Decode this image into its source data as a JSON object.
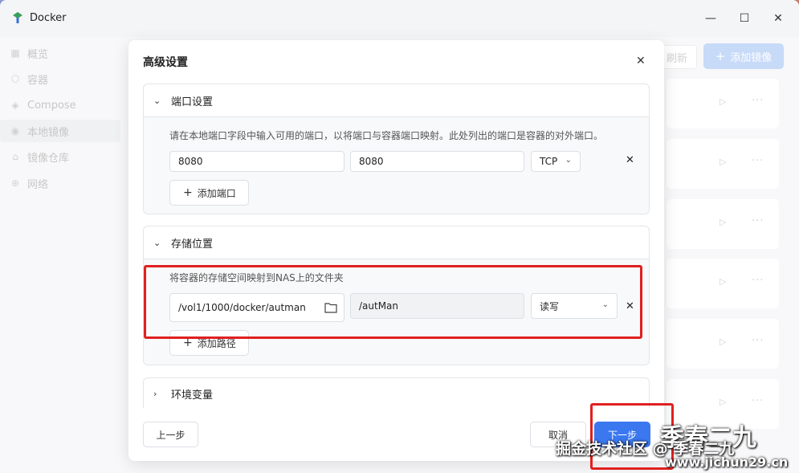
{
  "window": {
    "title": "Docker",
    "controls": {
      "minimize": "—",
      "maximize": "☐",
      "close": "✕"
    }
  },
  "sidebar": {
    "items": [
      {
        "label": "概览",
        "icon": "grid-icon"
      },
      {
        "label": "容器",
        "icon": "cube-icon"
      },
      {
        "label": "Compose",
        "icon": "layers-icon"
      },
      {
        "label": "本地镜像",
        "icon": "disk-icon",
        "active": true
      },
      {
        "label": "镜像仓库",
        "icon": "house-icon"
      },
      {
        "label": "网络",
        "icon": "globe-icon"
      }
    ]
  },
  "background": {
    "refresh_label": "刷新",
    "add_image_label": "添加镜像",
    "add_icon": "plus-icon"
  },
  "dialog": {
    "title": "高级设置",
    "close": "✕",
    "ports": {
      "title": "端口设置",
      "description": "请在本地端口字段中输入可用的端口，以将端口与容器端口映射。此处列出的端口是容器的对外端口。",
      "rows": [
        {
          "local_port": "8080",
          "container_port": "8080",
          "protocol": "TCP"
        }
      ],
      "add_label": "添加端口"
    },
    "storage": {
      "title": "存储位置",
      "description": "将容器的存储空间映射到NAS上的文件夹",
      "rows": [
        {
          "nas_path": "/vol1/1000/docker/autman",
          "container_path": "/autMan",
          "mode": "读写"
        }
      ],
      "add_label": "添加路径"
    },
    "env": {
      "title": "环境变量"
    },
    "footer": {
      "prev_label": "上一步",
      "cancel_label": "取消",
      "next_label": "下一步"
    }
  },
  "watermark": {
    "line1": "季春二九",
    "line2": "掘金技术社区 @ 季春二九",
    "line3": "www.jichun29.cn"
  },
  "colors": {
    "primary": "#3b78f0",
    "highlight_border": "#e02020"
  }
}
